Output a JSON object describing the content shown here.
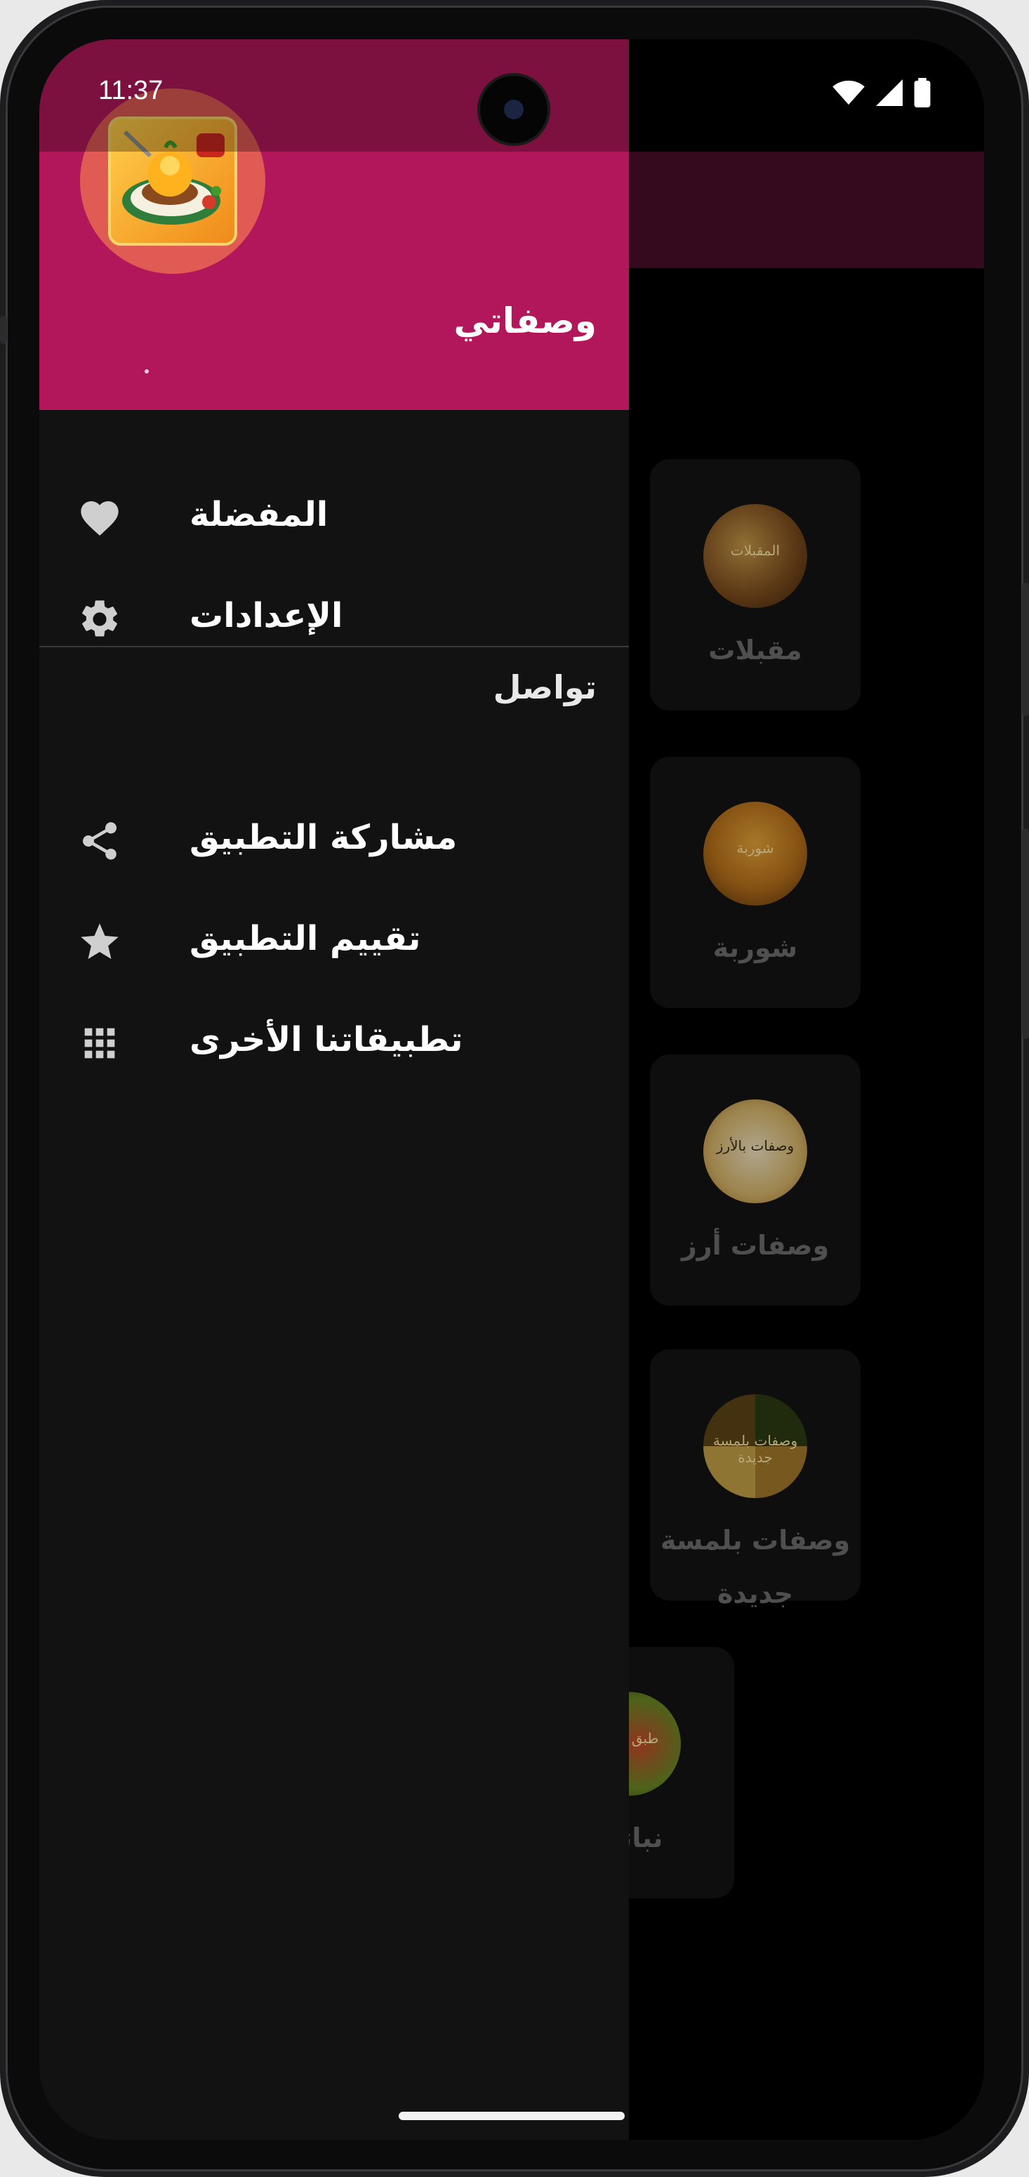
{
  "status_bar": {
    "time": "11:37"
  },
  "drawer": {
    "app_name": "وصفاتي",
    "logo_icon": "food-plate-icon",
    "menu": [
      {
        "label": "المفضلة",
        "icon": "heart-icon"
      },
      {
        "label": "الإعدادات",
        "icon": "gear-icon"
      }
    ],
    "section_title": "تواصل",
    "contact_menu": [
      {
        "label": "مشاركة التطبيق",
        "icon": "share-icon"
      },
      {
        "label": "تقييم التطبيق",
        "icon": "star-icon"
      },
      {
        "label": "تطبيقاتنا الأخرى",
        "icon": "apps-grid-icon"
      }
    ]
  },
  "categories": [
    {
      "title": "مقبلات",
      "thumb_text": "المقبلات"
    },
    {
      "title": "شوربة",
      "thumb_text": "شوربة"
    },
    {
      "title": "وصفات أرز",
      "thumb_text": "وصفات بالأرز"
    },
    {
      "title": "وصفات بلمسة جديدة",
      "thumb_text": "وصفات بلمسة جديدة"
    },
    {
      "title": "نباتي",
      "thumb_text": "طبق نباتي"
    }
  ],
  "colors": {
    "drawer_header": "#b2175b",
    "app_bar": "#4a0f2a",
    "drawer_bg": "#121212",
    "card_bg": "#141414"
  }
}
